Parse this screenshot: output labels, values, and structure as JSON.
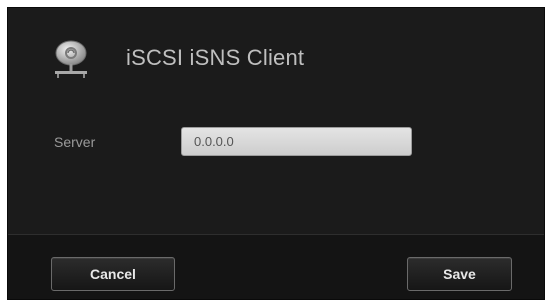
{
  "dialog": {
    "title": "iSCSI iSNS Client",
    "icon": "network-globe-icon"
  },
  "form": {
    "server_label": "Server",
    "server_value": "0.0.0.0"
  },
  "footer": {
    "cancel_label": "Cancel",
    "save_label": "Save"
  },
  "colors": {
    "dialog_background": "#1b1b1b",
    "title_text": "#bfbfbf",
    "input_background": "#d9d9d9"
  }
}
